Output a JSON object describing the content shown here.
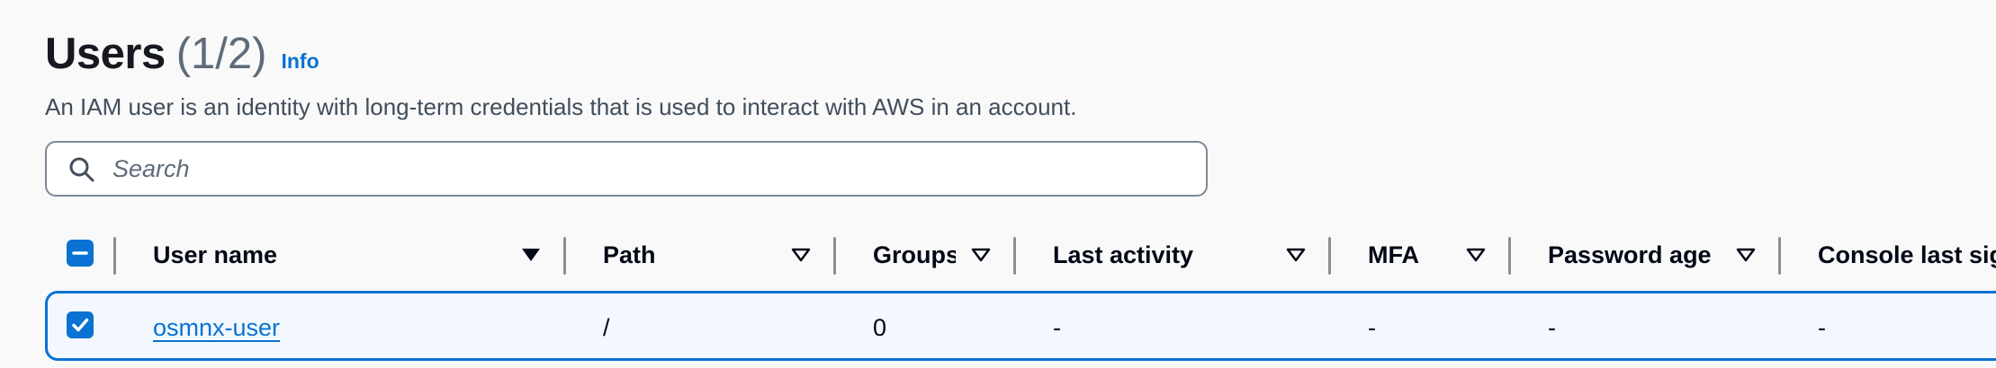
{
  "header": {
    "title": "Users",
    "count": "(1/2)",
    "info_link": "Info"
  },
  "description": "An IAM user is an identity with long-term credentials that is used to interact with AWS in an account.",
  "search": {
    "placeholder": "Search",
    "value": ""
  },
  "columns": [
    {
      "label": "User name",
      "sort": "descending"
    },
    {
      "label": "Path",
      "sort": "none"
    },
    {
      "label": "Groups",
      "sort": "none"
    },
    {
      "label": "Last activity",
      "sort": "none"
    },
    {
      "label": "MFA",
      "sort": "none"
    },
    {
      "label": "Password age",
      "sort": "none"
    },
    {
      "label": "Console last sign-in",
      "sort": "none"
    }
  ],
  "rows": [
    {
      "selected": true,
      "user_name": "osmnx-user",
      "path": "/",
      "groups": "0",
      "last_activity": "-",
      "mfa": "-",
      "password_age": "-",
      "console_last_signin": "-"
    }
  ],
  "colors": {
    "accent": "#0972d3",
    "selected_row_bg": "#f2f8fd"
  }
}
